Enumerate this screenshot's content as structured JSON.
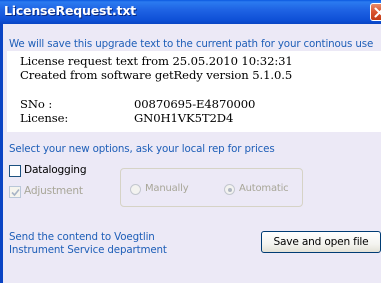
{
  "window": {
    "title": "LicenseRequest.txt",
    "title_bar_color": "#0e4fd6",
    "close_icon": "close-icon"
  },
  "intro_text": "We will save this upgrade text to the current path for your continous use",
  "license_text": {
    "line1": "License request text from 25.05.2010 10:32:31",
    "line2": "Created from software getRedy version 5.1.0.5",
    "sno_label": "SNo    :",
    "sno_value": "00870695-E4870000",
    "license_label": "License:",
    "license_value": "GN0H1VK5T2D4"
  },
  "options_hint": "Select your new options, ask your local rep for prices",
  "options": {
    "datalogging": {
      "label": "Datalogging",
      "checked": false,
      "enabled": true
    },
    "adjustment": {
      "label": "Adjustment",
      "checked": true,
      "enabled": false
    },
    "adjustment_mode": {
      "manually_label": "Manually",
      "automatic_label": "Automatic",
      "selected": "Automatic",
      "enabled": false
    }
  },
  "footer": {
    "send_line1": "Send the contend to Voegtlin",
    "send_line2": "Instrument Service department",
    "save_button_label": "Save and open file"
  },
  "colors": {
    "accent_text": "#1f5fb8",
    "disabled_text": "#a8a698",
    "dialog_background": "#ece9f6"
  }
}
